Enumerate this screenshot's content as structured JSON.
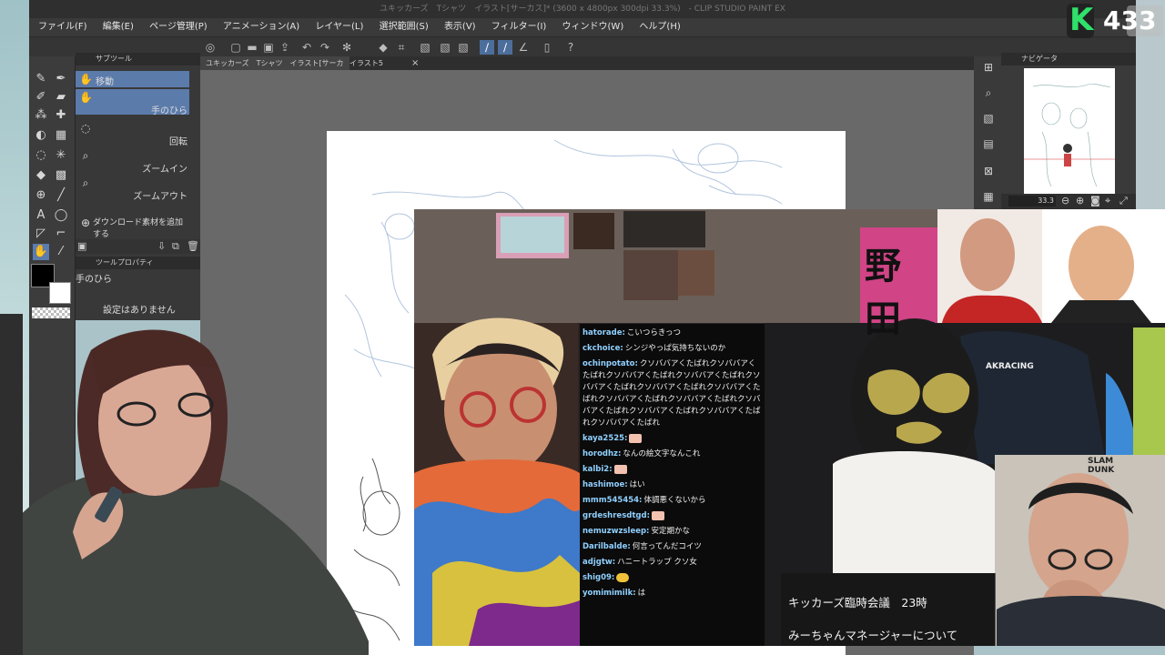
{
  "app": {
    "title": "ユキッカーズ　Tシャツ　イラスト[サーカス]* (3600 x 4800px 300dpi 33.3%)　- CLIP STUDIO PAINT EX"
  },
  "menu": [
    "ファイル(F)",
    "編集(E)",
    "ページ管理(P)",
    "アニメーション(A)",
    "レイヤー(L)",
    "選択範囲(S)",
    "表示(V)",
    "フィルター(I)",
    "ウィンドウ(W)",
    "ヘルプ(H)"
  ],
  "subtool": {
    "header": "サブツール",
    "items": [
      {
        "label": "移動",
        "icon": "hand-icon"
      },
      {
        "label": "手のひら",
        "icon": "hand-icon"
      },
      {
        "label": "回転",
        "icon": "rotate-icon"
      },
      {
        "label": "ズームイン",
        "icon": "zoom-in-icon"
      },
      {
        "label": "ズームアウト",
        "icon": "zoom-out-icon"
      }
    ],
    "add_material": "ダウンロード素材を追加する"
  },
  "tool_property": {
    "header": "ツールプロパティ",
    "tool_name": "手のひら",
    "no_settings": "設定はありません"
  },
  "doc_tabs": [
    {
      "label": "ユキッカーズ　Tシャツ　イラスト[サーカス]*"
    },
    {
      "label": "イラスト5"
    }
  ],
  "navigator": {
    "header": "ナビゲータ",
    "zoom": "33.3"
  },
  "logo": {
    "letter": "K",
    "number": "433"
  },
  "chat": [
    {
      "user": "hatorade:",
      "text": "こいつらきっつ"
    },
    {
      "user": "ckchoice:",
      "text": "シンジやっぱ気持ちないのか"
    },
    {
      "user": "ochinpotato:",
      "text": "クソババアくたばれクソババアくたばれクソババアくたばれクソババアくたばれクソババアくたばれクソババアくたばれクソババアくたばれクソババアくたばれクソババアくたばれクソババアくたばれクソババアくたばれクソババアくたばれクソババアくたばれ"
    },
    {
      "user": "kaya2525:",
      "text": ""
    },
    {
      "user": "horodhz:",
      "text": "なんの絵文字なんこれ"
    },
    {
      "user": "kalbi2:",
      "text": ""
    },
    {
      "user": "hashimoe:",
      "text": "はい"
    },
    {
      "user": "mmm545454:",
      "text": "体調悪くないから"
    },
    {
      "user": "grdeshresdtgd:",
      "text": ""
    },
    {
      "user": "nemuzwzsleep:",
      "text": "安定期かな"
    },
    {
      "user": "Darilbalde:",
      "text": "何言ってんだコイツ"
    },
    {
      "user": "adjgtw:",
      "text": "ハニートラップ クソ女"
    },
    {
      "user": "shig09:",
      "text": ""
    },
    {
      "user": "yomimimilk:",
      "text": "は"
    }
  ],
  "banner": {
    "text": "野田"
  },
  "chair_brand": "AKRACING",
  "cap_text": "SLAM DUNK",
  "caption": {
    "line1": "キッカーズ臨時会議　23時",
    "line2": "みーちゃんマネージャーについて"
  }
}
